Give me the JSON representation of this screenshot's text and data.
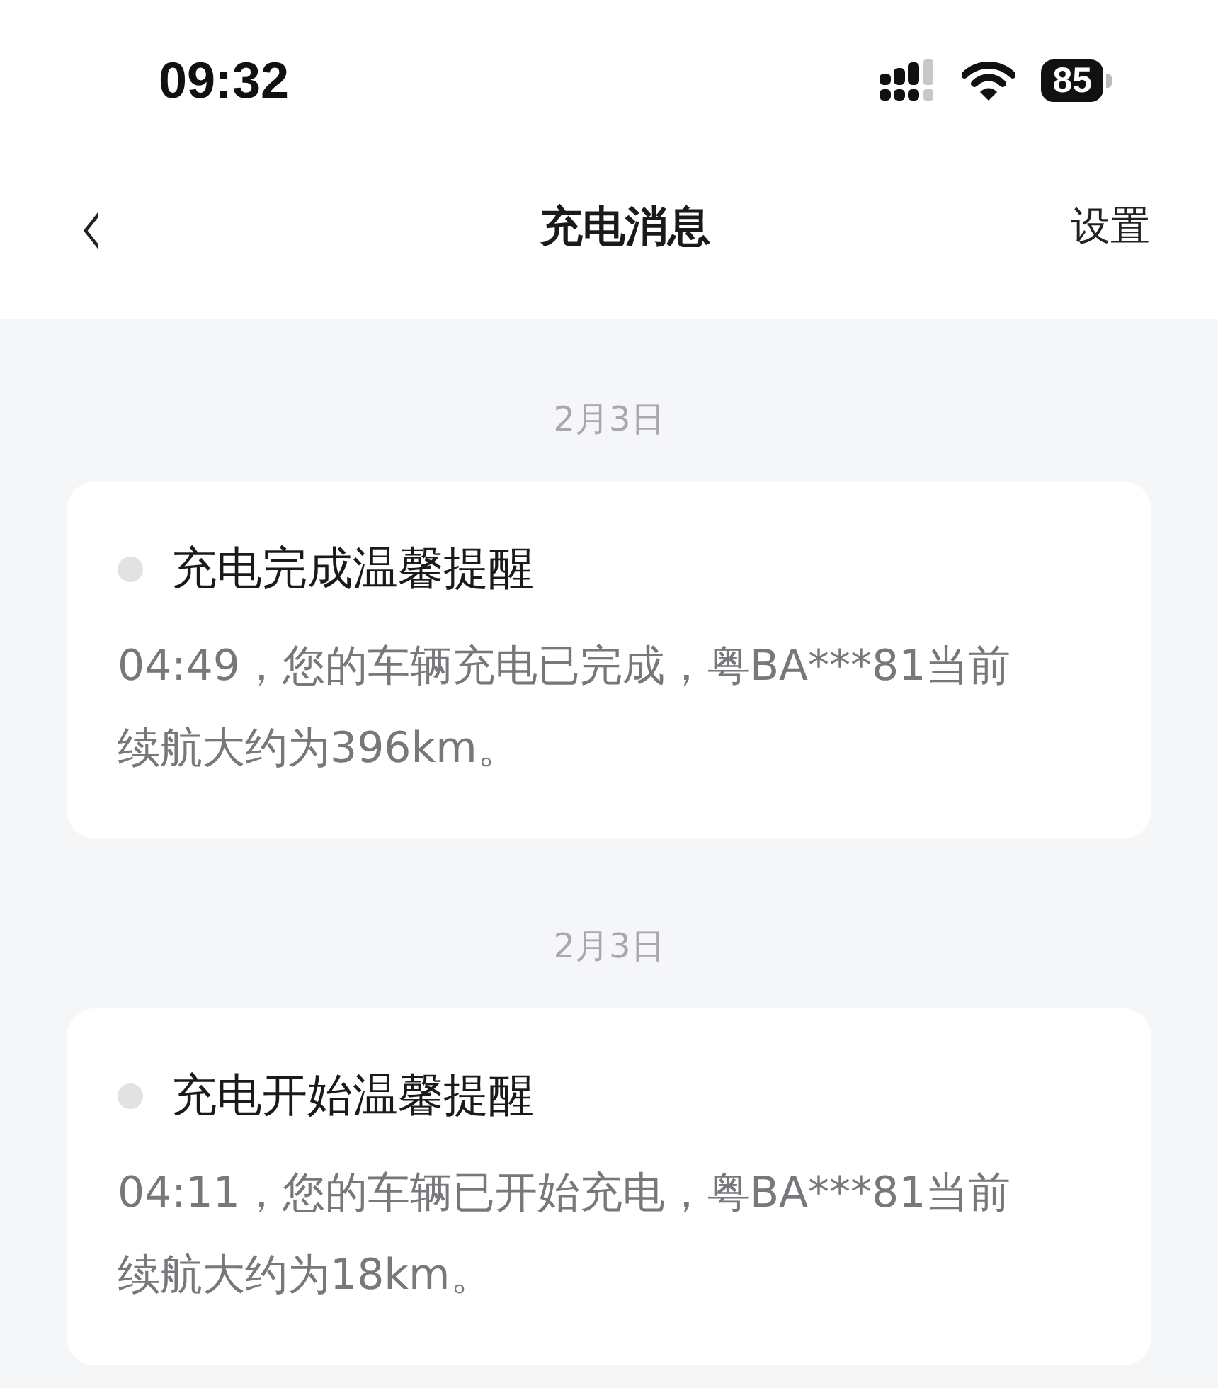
{
  "status_bar": {
    "time": "09:32",
    "battery": "85"
  },
  "nav": {
    "back": "‹",
    "title": "充电消息",
    "action": "设置"
  },
  "messages": [
    {
      "date": "2月3日",
      "title": "充电完成温馨提醒",
      "read": true,
      "body": "04:49，您的车辆充电已完成，粤BA***81当前续航大约为396km。"
    },
    {
      "date": "2月3日",
      "title": "充电开始温馨提醒",
      "read": true,
      "body": "04:11，您的车辆已开始充电，粤BA***81当前续航大约为18km。"
    }
  ]
}
